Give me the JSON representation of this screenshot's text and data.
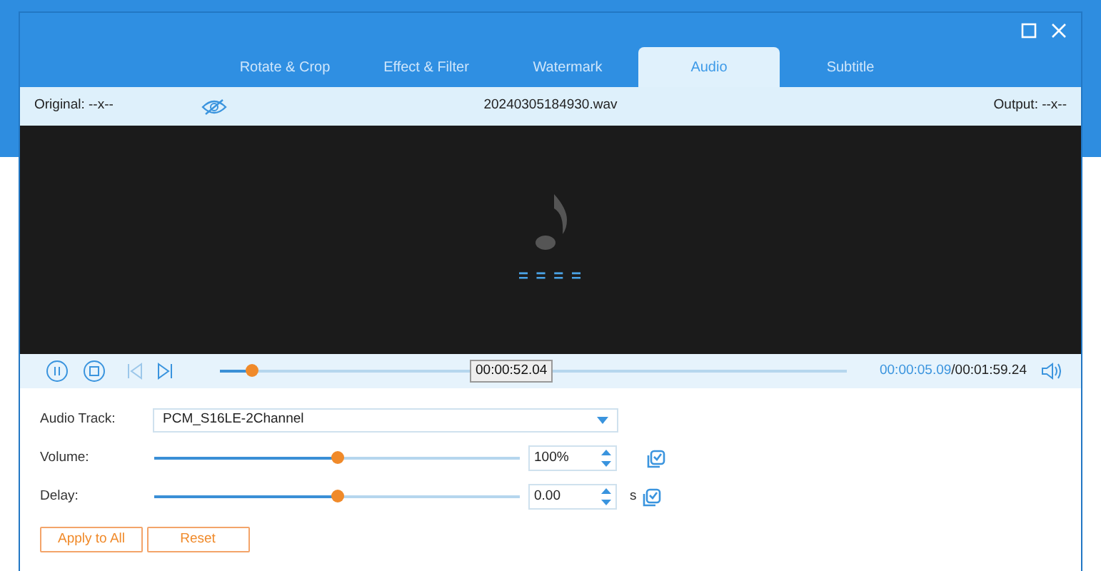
{
  "tabs": [
    {
      "label": "Rotate & Crop",
      "selected": false
    },
    {
      "label": "Effect & Filter",
      "selected": false
    },
    {
      "label": "Watermark",
      "selected": false
    },
    {
      "label": "Audio",
      "selected": true
    },
    {
      "label": "Subtitle",
      "selected": false
    }
  ],
  "info_bar": {
    "original": "Original: --x--",
    "filename": "20240305184930.wav",
    "output": "Output: --x--"
  },
  "preview": {
    "indicator": "= = = ="
  },
  "player": {
    "seek": {
      "level": 0.05,
      "tooltip": "00:00:52.04"
    },
    "current_time": "00:00:05.09",
    "total_time": "/00:01:59.24",
    "playing": true
  },
  "settings": {
    "audio_track": {
      "label": "Audio Track:",
      "value": "PCM_S16LE-2Channel"
    },
    "volume": {
      "label": "Volume:",
      "level": 0.5,
      "value": "100%"
    },
    "delay": {
      "label": "Delay:",
      "level": 0.5,
      "value": "0.00",
      "unit": "s"
    }
  },
  "buttons": [
    "Apply to All",
    "Reset"
  ]
}
